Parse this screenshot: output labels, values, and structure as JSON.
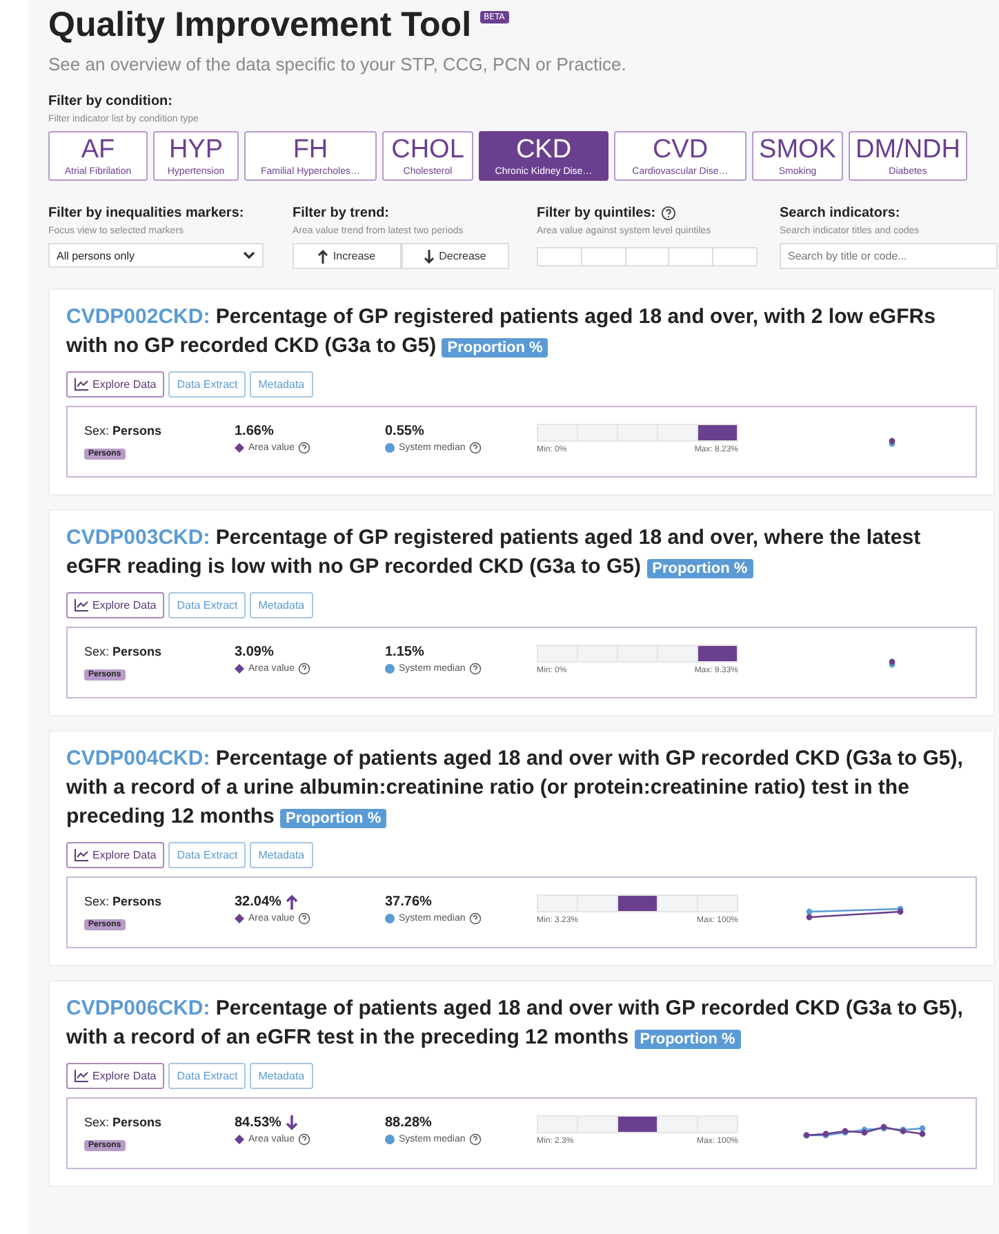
{
  "header": {
    "title": "Quality Improvement Tool",
    "badge": "BETA",
    "subtitle": "See an overview of the data specific to your STP, CCG, PCN or Practice."
  },
  "condition_filter": {
    "label": "Filter by condition:",
    "hint": "Filter indicator list by condition type",
    "conditions": [
      {
        "code": "AF",
        "name": "Atrial Fibrilation",
        "selected": false
      },
      {
        "code": "HYP",
        "name": "Hypertension",
        "selected": false
      },
      {
        "code": "FH",
        "name": "Familial Hypercholes…",
        "selected": false
      },
      {
        "code": "CHOL",
        "name": "Cholesterol",
        "selected": false
      },
      {
        "code": "CKD",
        "name": "Chronic Kidney Dise…",
        "selected": true
      },
      {
        "code": "CVD",
        "name": "Cardiovascular Dise…",
        "selected": false
      },
      {
        "code": "SMOK",
        "name": "Smoking",
        "selected": false
      },
      {
        "code": "DM/NDH",
        "name": "Diabetes",
        "selected": false
      }
    ]
  },
  "filters": {
    "inequalities": {
      "label": "Filter by inequalities markers:",
      "hint": "Focus view to selected markers",
      "value": "All persons only"
    },
    "trend": {
      "label": "Filter by trend:",
      "hint": "Area value trend from latest two periods",
      "buttons": [
        {
          "label": "Increase",
          "kind": "up"
        },
        {
          "label": "Decrease",
          "kind": "down"
        }
      ]
    },
    "quintiles": {
      "label": "Filter by quintiles:",
      "hint": "Area value against system level quintiles"
    },
    "search": {
      "label": "Search indicators:",
      "hint": "Search indicator titles and codes",
      "placeholder": "Search by title or code..."
    }
  },
  "indicators": [
    {
      "code": "CVDP002CKD:",
      "title": "Percentage of GP registered patients aged 18 and over, with 2 low eGFRs with no GP recorded CKD (G3a to G5)",
      "badge": "Proportion %",
      "actions": [
        "Explore Data",
        "Data Extract",
        "Metadata"
      ],
      "sex_label": "Sex:",
      "sex": "Persons",
      "tag": "Persons",
      "area_value": "1.66%",
      "area_label": "Area value",
      "median": "0.55%",
      "median_label": "System median",
      "quintiles": [
        {
          "selected": false
        },
        {
          "selected": false
        },
        {
          "selected": false
        },
        {
          "selected": false
        },
        {
          "selected": true
        }
      ],
      "min": "Min: 0%",
      "max": "Max: 8.23%",
      "sparkline": {
        "kind": "dot"
      }
    },
    {
      "code": "CVDP003CKD:",
      "title": "Percentage of GP registered patients aged 18 and over, where the latest eGFR reading is low with no GP recorded CKD (G3a to G5)",
      "badge": "Proportion %",
      "actions": [
        "Explore Data",
        "Data Extract",
        "Metadata"
      ],
      "sex_label": "Sex:",
      "sex": "Persons",
      "tag": "Persons",
      "area_value": "3.09%",
      "area_label": "Area value",
      "median": "1.15%",
      "median_label": "System median",
      "quintiles": [
        {
          "selected": false
        },
        {
          "selected": false
        },
        {
          "selected": false
        },
        {
          "selected": false
        },
        {
          "selected": true
        }
      ],
      "min": "Min: 0%",
      "max": "Max: 9.33%",
      "sparkline": {
        "kind": "dot"
      }
    },
    {
      "code": "CVDP004CKD:",
      "title": "Percentage of patients aged 18 and over with GP recorded CKD (G3a to G5), with a record of a urine albumin:creatinine ratio (or protein:creatinine ratio) test in the preceding 12 months",
      "badge": "Proportion %",
      "actions": [
        "Explore Data",
        "Data Extract",
        "Metadata"
      ],
      "sex_label": "Sex:",
      "sex": "Persons",
      "tag": "Persons",
      "area_value": "32.04%",
      "trend": {
        "kind": "up"
      },
      "area_label": "Area value",
      "median": "37.76%",
      "median_label": "System median",
      "quintiles": [
        {
          "selected": false
        },
        {
          "selected": false
        },
        {
          "selected": true
        },
        {
          "selected": false
        },
        {
          "selected": false
        }
      ],
      "min": "Min: 3.23%",
      "max": "Max: 100%",
      "sparkline": {
        "kind": "two"
      }
    },
    {
      "code": "CVDP006CKD:",
      "title": "Percentage of patients aged 18 and over with GP recorded CKD (G3a to G5), with a record of an eGFR test in the preceding 12 months",
      "badge": "Proportion %",
      "actions": [
        "Explore Data",
        "Data Extract",
        "Metadata"
      ],
      "sex_label": "Sex:",
      "sex": "Persons",
      "tag": "Persons",
      "area_value": "84.53%",
      "trend": {
        "kind": "down"
      },
      "area_label": "Area value",
      "median": "88.28%",
      "median_label": "System median",
      "quintiles": [
        {
          "selected": false
        },
        {
          "selected": false
        },
        {
          "selected": true
        },
        {
          "selected": false
        },
        {
          "selected": false
        }
      ],
      "min": "Min: 2.3%",
      "max": "Max: 100%",
      "sparkline": {
        "kind": "multi"
      }
    }
  ]
}
